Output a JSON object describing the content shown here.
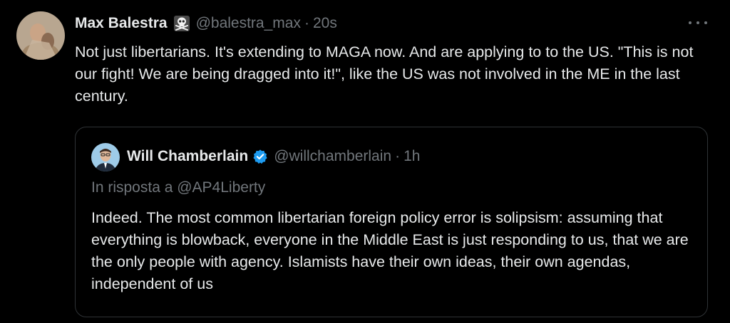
{
  "tweet": {
    "author": {
      "name": "Max Balestra",
      "badge_icon": "skull-crossbones-icon",
      "handle": "@balestra_max",
      "separator": "·",
      "time": "20s"
    },
    "text": "Not just libertarians. It's extending to MAGA now. And are applying to to the US. \"This is not our fight! We are being dragged into it!\", like the US was not involved in the ME in the last century.",
    "more_icon": "more-horizontal-icon"
  },
  "quote": {
    "author": {
      "name": "Will Chamberlain",
      "verified_icon": "verified-badge-icon",
      "handle": "@willchamberlain",
      "separator": "·",
      "time": "1h"
    },
    "reply_to": "In risposta a @AP4Liberty",
    "text": "Indeed. The most common libertarian foreign policy error is solipsism: assuming that everything is blowback, everyone in the Middle East is just responding to us, that we are the only people with agency. Islamists have their own ideas, their own agendas, independent of us"
  },
  "colors": {
    "background": "#000000",
    "text_primary": "#e7e9ea",
    "text_secondary": "#71767b",
    "border": "#2f3336",
    "verified_blue": "#1d9bf0"
  }
}
